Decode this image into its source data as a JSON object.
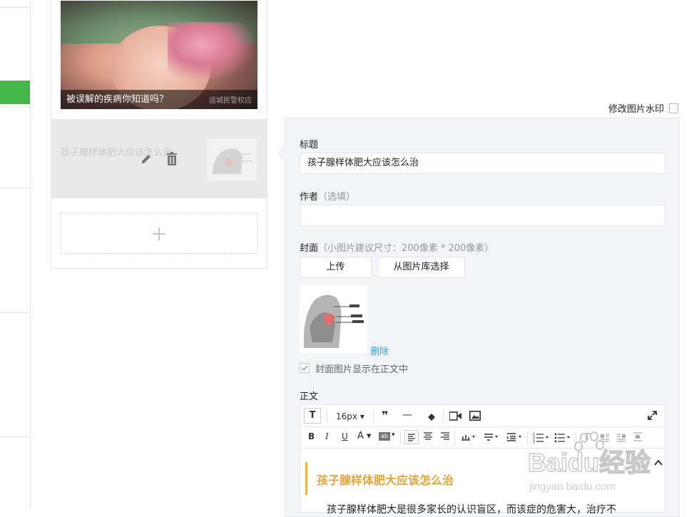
{
  "article_list": {
    "first": {
      "caption": "被误解的疾病你知道吗？",
      "image_watermark": "运城民警权应"
    },
    "second": {
      "title": "孩子腺样体肥大应该怎么治"
    },
    "add_label": "+"
  },
  "watermark_link": "修改图片水印",
  "form": {
    "title_label": "标题",
    "title_value": "孩子腺样体肥大应该怎么治",
    "author_label": "作者",
    "author_hint": "（选填）",
    "author_value": "",
    "cover_label": "封面",
    "cover_hint": "（小图片建议尺寸：200像素 * 200像素）",
    "upload_button": "上传",
    "library_button": "从图片库选择",
    "delete_link": "删除",
    "show_in_body_checked": true,
    "show_in_body_label": "封面图片显示在正文中",
    "body_label": "正文"
  },
  "toolbar": {
    "font_size": "16px",
    "quote_glyph": "❞",
    "hr_glyph": "—",
    "bold": "B",
    "italic": "I",
    "underline": "U",
    "font_color": "A"
  },
  "content": {
    "heading": "孩子腺样体肥大应该怎么治",
    "body_start": "孩子腺样体肥大是很多家长的认识盲区，而该症的危害大，治疗不"
  },
  "site_watermark": {
    "brand": "Baidu经验",
    "url": "jingyan.baidu.com"
  },
  "colors": {
    "accent_green": "#44b549",
    "link_blue": "#459ae9",
    "heading_orange": "#e6a33a"
  }
}
